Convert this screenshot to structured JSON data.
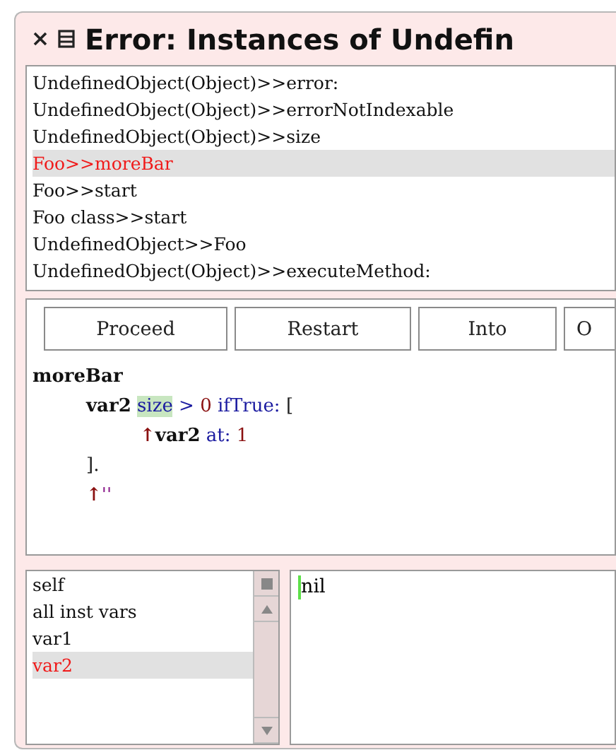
{
  "window": {
    "title": "Error: Instances of Undefin"
  },
  "stack": [
    {
      "label": "UndefinedObject(Object)>>error:",
      "selected": false
    },
    {
      "label": "UndefinedObject(Object)>>errorNotIndexable",
      "selected": false
    },
    {
      "label": "UndefinedObject(Object)>>size",
      "selected": false
    },
    {
      "label": "Foo>>moreBar",
      "selected": true
    },
    {
      "label": "Foo>>start",
      "selected": false
    },
    {
      "label": "Foo class>>start",
      "selected": false
    },
    {
      "label": "UndefinedObject>>Foo",
      "selected": false
    },
    {
      "label": "UndefinedObject(Object)>>executeMethod:",
      "selected": false
    }
  ],
  "buttons": [
    "Proceed",
    "Restart",
    "Into",
    "O"
  ],
  "code": [
    [
      {
        "kind": "bold",
        "text": "moreBar"
      }
    ],
    [
      {
        "kind": "bold",
        "text": "var2"
      },
      {
        "kind": "selector",
        "text": "size",
        "highlighted": true
      },
      {
        "kind": "selector",
        "text": ">"
      },
      {
        "kind": "number",
        "text": "0"
      },
      {
        "kind": "selector",
        "text": "ifTrue:"
      },
      {
        "kind": "plain",
        "text": "["
      }
    ],
    [
      {
        "kind": "return",
        "text": "↑"
      },
      {
        "kind": "bold",
        "text": "var2"
      },
      {
        "kind": "selector",
        "text": "at:"
      },
      {
        "kind": "number",
        "text": "1"
      }
    ],
    [
      {
        "kind": "plain",
        "text": "]."
      }
    ],
    [
      {
        "kind": "return",
        "text": "↑"
      },
      {
        "kind": "string",
        "text": "''"
      }
    ]
  ],
  "variables": [
    {
      "label": "self",
      "selected": false
    },
    {
      "label": "all inst vars",
      "selected": false
    },
    {
      "label": "var1",
      "selected": false
    },
    {
      "label": "var2",
      "selected": true
    }
  ],
  "value": "nil"
}
